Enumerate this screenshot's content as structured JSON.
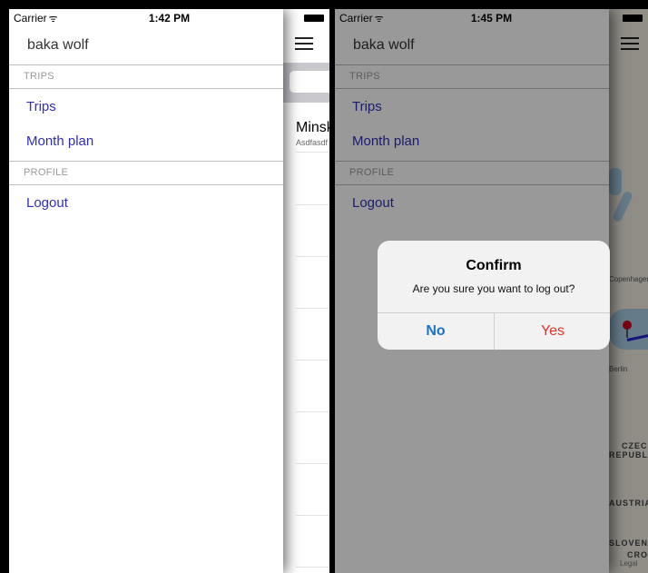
{
  "status_left": {
    "carrier": "Carrier",
    "wifi": "ᯤ",
    "time": "1:42 PM"
  },
  "status_right": {
    "carrier": "Carrier",
    "wifi": "ᯤ",
    "time": "1:45 PM"
  },
  "drawer": {
    "user_name": "baka wolf",
    "sections": [
      {
        "header": "TRIPS",
        "items": [
          "Trips",
          "Month plan"
        ]
      },
      {
        "header": "PROFILE",
        "items": [
          "Logout"
        ]
      }
    ]
  },
  "trips_list": {
    "first_trip_title": "Minsk",
    "first_trip_subtitle": "Asdfasdf"
  },
  "map": {
    "labels": [
      "Copenhagen",
      "Berlin",
      "CZECH",
      "REPUBLIC",
      "AUSTRIA",
      "SLOVENIA",
      "CROATIA"
    ],
    "legal": "Legal"
  },
  "alert": {
    "title": "Confirm",
    "message": "Are you sure you want to log out?",
    "no_label": "No",
    "yes_label": "Yes"
  },
  "colors": {
    "link": "#2f2fb7",
    "no_button": "#1a73c8",
    "yes_button": "#e0342c"
  }
}
